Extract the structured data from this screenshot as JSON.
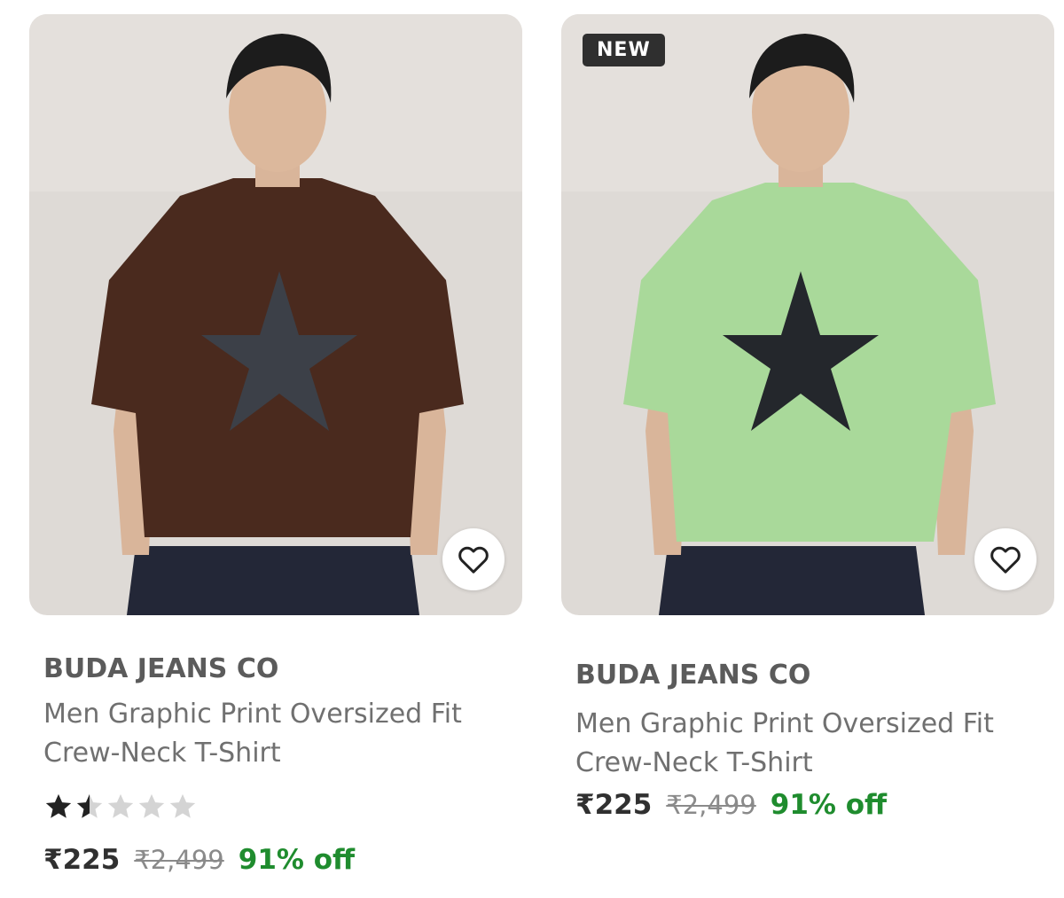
{
  "products": [
    {
      "brand": "BUDA JEANS CO",
      "title_line1": "Men Graphic Print Oversized Fit",
      "title_line2": "Crew-Neck T-Shirt",
      "price": "₹225",
      "mrp": "₹2,499",
      "discount": "91% off",
      "rating": 1.5,
      "rating_max": 5,
      "shirt_color": "#4a2a1e",
      "image_icon": "model-wearing-brown-star-tshirt-image"
    },
    {
      "badge": "NEW",
      "brand": "BUDA JEANS CO",
      "title_line1": "Men Graphic Print Oversized Fit",
      "title_line2": "Crew-Neck T-Shirt",
      "price": "₹225",
      "mrp": "₹2,499",
      "discount": "91% off",
      "shirt_color": "#a9d99a",
      "image_icon": "model-wearing-green-star-tshirt-image"
    }
  ],
  "colors": {
    "background": "#ffffff",
    "image_backdrop": "#dedad6",
    "brand_text": "#5b5b5b",
    "title_text": "#707070",
    "price_text": "#303030",
    "mrp_text": "#8a8a8a",
    "discount_text": "#1f8c2e",
    "badge_bg": "#2f2f2f",
    "star_filled": "#222222",
    "star_empty": "#d4d4d4"
  },
  "icons": {
    "wishlist": "heart-outline-icon",
    "rating_star": "star-icon"
  }
}
